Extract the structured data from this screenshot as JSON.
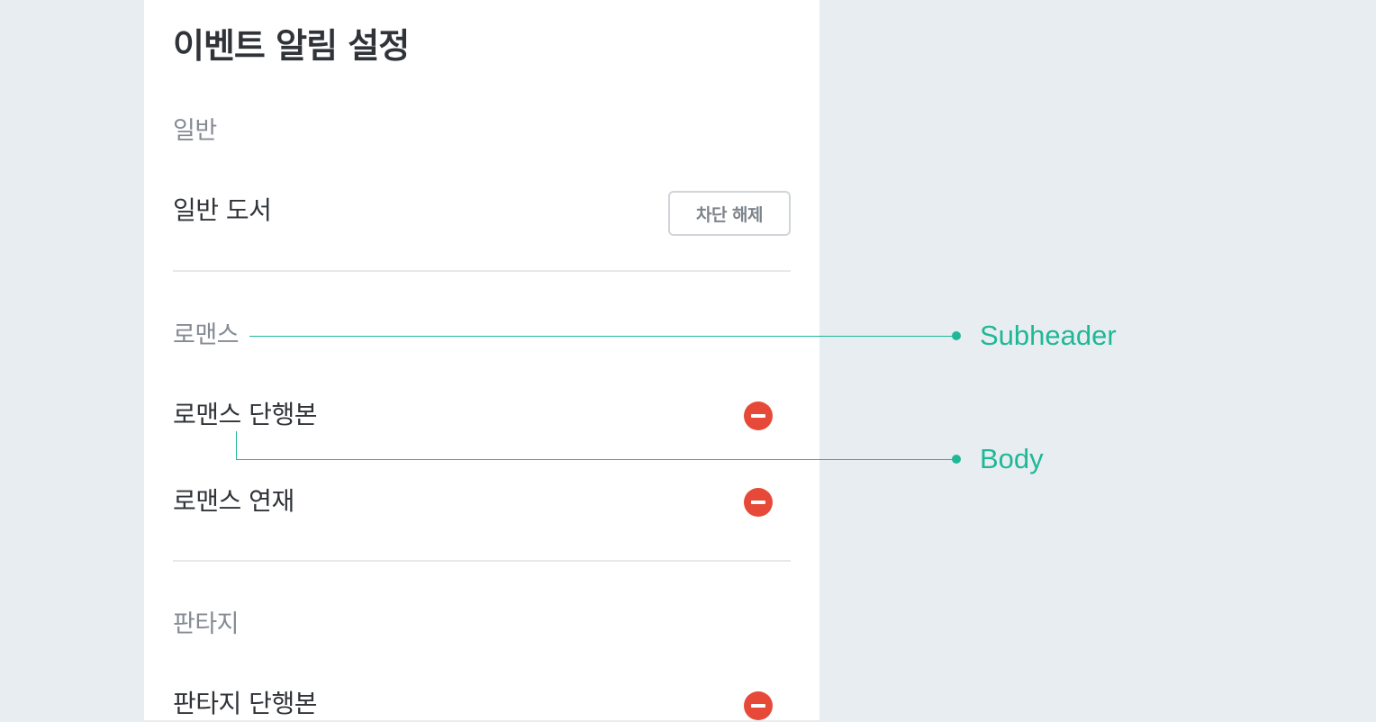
{
  "page": {
    "title": "이벤트 알림 설정"
  },
  "sections": [
    {
      "subheader": "일반",
      "items": [
        {
          "label": "일반 도서",
          "action": "button",
          "button_label": "차단 해제"
        }
      ]
    },
    {
      "subheader": "로맨스",
      "items": [
        {
          "label": "로맨스 단행본",
          "action": "remove-icon"
        },
        {
          "label": "로맨스 연재",
          "action": "remove-icon"
        }
      ]
    },
    {
      "subheader": "판타지",
      "items": [
        {
          "label": "판타지 단행본",
          "action": "remove-icon"
        }
      ]
    }
  ],
  "annotations": {
    "subheader_label": "Subheader",
    "body_label": "Body"
  },
  "colors": {
    "background": "#e8edf1",
    "panel": "#ffffff",
    "title_text": "#303338",
    "subheader_text": "#858b93",
    "divider": "#e6e8eb",
    "remove_icon": "#e64938",
    "annotation_accent": "#1fb897"
  }
}
